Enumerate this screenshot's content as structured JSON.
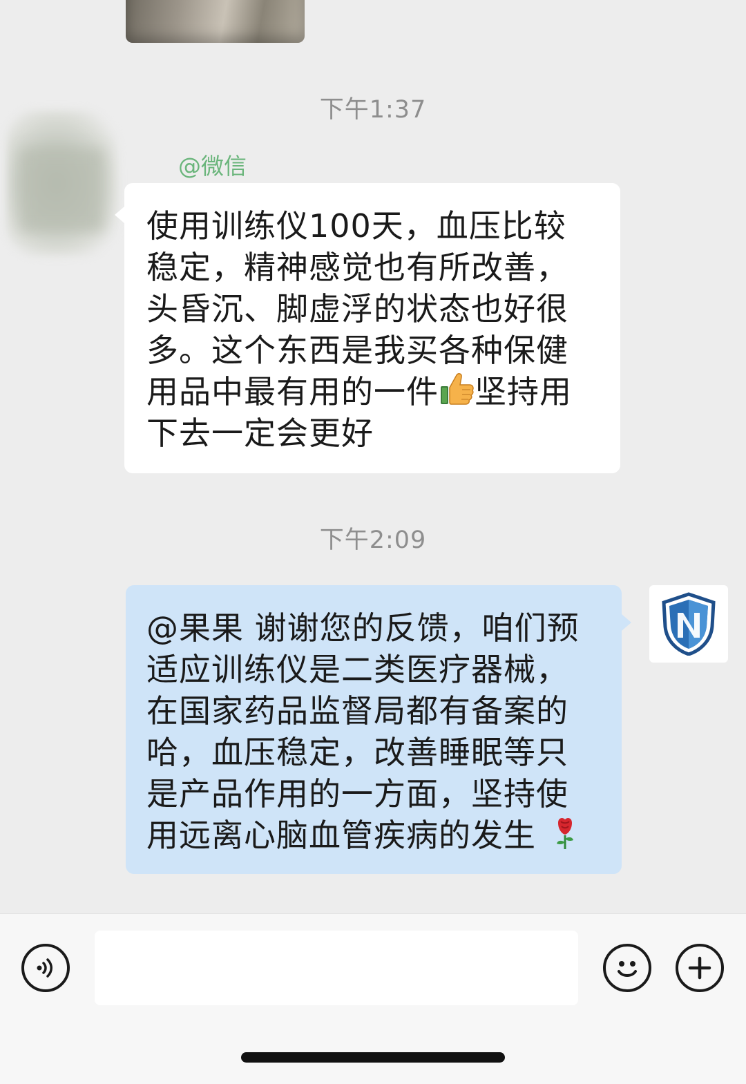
{
  "chat": {
    "timestamps": [
      "下午1:37",
      "下午2:09"
    ],
    "incoming": {
      "sender": "@微信",
      "lines": [
        "使用训练仪100天，血压比较",
        "稳定，精神感觉也有所改善，",
        "头昏沉、脚虚浮的状态也好很",
        "多。这个东西是我买各种保健",
        "用品中最有用的一件",
        "坚持用",
        "下去一定会更好"
      ],
      "emoji": "thumbs-up-icon"
    },
    "outgoing": {
      "lines": [
        "@果果 谢谢您的反馈，咱们预",
        "适应训练仪是二类医疗器械，",
        "在国家药品监督局都有备案的",
        "哈，血压稳定，改善睡眠等只",
        "是产品作用的一方面，坚持使",
        "用远离心脑血管疾病的发生"
      ],
      "emoji": "rose-icon",
      "avatar": "shield-logo-icon"
    }
  },
  "input_bar": {
    "placeholder": "",
    "buttons": [
      "voice-icon",
      "emoji-icon",
      "plus-icon"
    ]
  },
  "colors": {
    "background": "#ededed",
    "incoming_bubble": "#ffffff",
    "outgoing_bubble": "#cfe4f8",
    "sender_name": "#3fa355",
    "timestamp": "#8e8e8e"
  }
}
